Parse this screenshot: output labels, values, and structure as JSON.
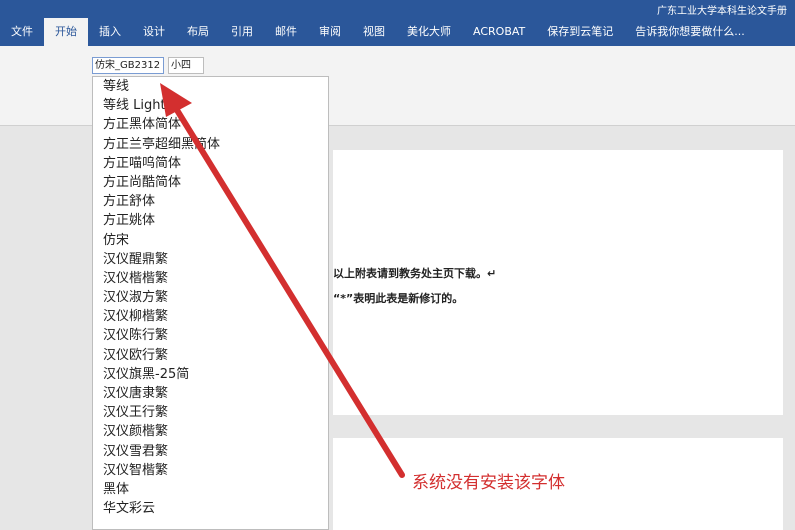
{
  "title": "广东工业大学本科生论文手册",
  "tabs": [
    "文件",
    "开始",
    "插入",
    "设计",
    "布局",
    "引用",
    "邮件",
    "审阅",
    "视图",
    "美化大师",
    "ACROBAT",
    "保存到云笔记",
    "告诉我你想要做什么..."
  ],
  "font": {
    "current": "仿宋_GB2312",
    "size": "小四"
  },
  "font_list": [
    "等线",
    "等线 Light",
    "方正黑体简体",
    "方正兰亭超细黑简体",
    "方正喵呜简体",
    "方正尚酷简体",
    "方正舒体",
    "方正姚体",
    "仿宋",
    "汉仪醒鼎繁",
    "汉仪楷楷繁",
    "汉仪淑方繁",
    "汉仪柳楷繁",
    "汉仪陈行繁",
    "汉仪欧行繁",
    "汉仪旗黑-25简",
    "汉仪唐隶繁",
    "汉仪王行繁",
    "汉仪颜楷繁",
    "汉仪雪君繁",
    "汉仪智楷繁",
    "黑体",
    "华文彩云"
  ],
  "doc": {
    "line1": "以上附表请到教务处主页下载。↵",
    "line2": "“*”表明此表是新修订的。"
  },
  "annotation": "系统没有安装该字体"
}
